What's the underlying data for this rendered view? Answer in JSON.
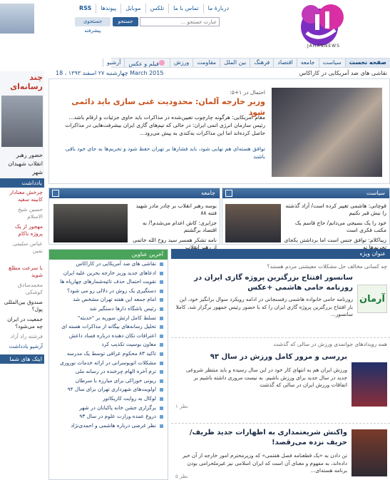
{
  "top_nav": [
    "دربارهٔ ما",
    "تماس با ما",
    "تلکس",
    "موبایل",
    "پیوندها",
    "RSS"
  ],
  "search": {
    "placeholder": "عبارت جستجو ...",
    "button": "جستجو",
    "advanced": "جستجوی پیشرفته"
  },
  "logo": {
    "en": "JAHANNEWS"
  },
  "main_nav": [
    "صفحه نخست",
    "سیاست",
    "جامعه",
    "اقتصاد",
    "فرهنگ",
    "بین الملل",
    "مقاومت",
    "ورزش",
    "فیلم و عکس",
    "آرشیو"
  ],
  "ticker": "نقاشی های ضد آمریکایی در کاراکاس",
  "date": "چهارشنبه ۲۷ اسفند ۱۳۹۳ ، 18 March 2015",
  "featured": {
    "kicker": "احتمال در ۱+۵:",
    "title": "وزیر خارجه آلمان: محدودیت غنی سازی باید دائمی شود",
    "body": "مقام آمریکایی: هرگونه چارچوب تعیین‌شده در مذاکرات باید حاوی جزئیات و ارقام باشد... رئیس سازمان انرژی اتمی ایران: در حالی که تیم‌های گازی ایران بیشرفت‌هایی در مذاکرات حاصل کرده‌اند اما این مذاکرات به‌کندی به پیش می‌رود...",
    "links": "توافق هسته‌ای هم نهایی شود، باید فشارها بر تهران حفظ شود و تحریم‌ها به جای خود باقی باشند"
  },
  "politics": {
    "title": "سیاست",
    "items": [
      "قوچانی: هاشمی تغییر کرده است/ آزاد گذشته را نبش قبر نکنیم",
      "خود را یک بسیجی می‌دانم/ حاج قاسم یک مکتب فکری است",
      "زیباکلام: توافق جنس است اما برداشتن یکجای تحریم‌ها نه"
    ]
  },
  "society": {
    "title": "جامعه",
    "items": [
      "بوسه رهبر انقلاب بر چادر مادر شهید فتنه ۸۸",
      "جزایری: کاش اعدام می‌شدم!/ به اقتصاد برگشتم",
      "نامه تشکر همسر سید روح الله خاتمی از رهبر انقلاب"
    ]
  },
  "left_col": {
    "headline": "چند رسانه‌ای",
    "caption": "حضور رهبر انقلاب شهیدان شهر",
    "section": "یادداشت",
    "notes": [
      "چرخش معنادار کابینه سفید",
      "حسین شیخ الاسلام",
      "مهجور از یک پروژه ناکام",
      "عباس سلیمی نمین"
    ],
    "notes2": [
      "با سرعت مطلع شوید",
      "محمدصادق کوشکی",
      "صندوق بین‌المللی پول؟",
      "جمعیت در ایران چه می‌شود؟",
      "فرشته راد آزاد"
    ],
    "arch": "آرشیو یادداشت",
    "socials": "ایتک های شما"
  },
  "latest": {
    "title": "آخرین عناوین",
    "items": [
      "نقاشی های ضد آمریکایی در کاراکاس",
      "ادعاهای جدید وزیر خارجه بحرین علیه ایران",
      "تقویت احتمال حذف تائیه‌شمارهای چهارپاه ها",
      "دستگیری یک روش در دلالی رو می شود؟",
      "امام جمعه این هفته تهران مشخص شد",
      "رئیس باشگاه دارها دستگیر شد",
      "تسلط کامل ارتش سوریه بر \"حدیثه\"",
      "تحلیل رسانه‌های بیگانه از مذاکرات هسته ای",
      "اعترافات تکان دهنده درباره فساد داعش",
      "معاون بوسیت تکذیب کرد",
      "تاکید ۸۳ محکوم عراقی توسط یک مدرسه",
      "مشکلات اتوبوسرانی در ارائه خدمات نوروزی",
      "ترم آخره الهام چرخنده در رسانه ملی",
      "ریونی خوزاکی برای مبارزه با سرطان",
      "اولویت‌های شهرداری تهران برای سال ۹۴",
      "لوکال به روایت کاریکاتور",
      "برگزاری جشن خانه پاکبانان در شهر",
      "دروغ عمده وزارت علوم در سال ۹۳",
      "نظر غرضی درباره هاشمی و احمدی‌نژاد"
    ]
  },
  "special": {
    "title": "عنوان ویژه",
    "items": [
      {
        "kicker": "چه کسانی مخالف حل مشکلات معیشتی مردم هستند؟",
        "title": "سانسور افتتاح بزرگترین پروژه گازی ایران در روزنامه حامی هاشمی +عکس",
        "body": "روزنامه حامی خانواده هاشمی رفسنجانی در ادامه رویکرد سوال برانگیز خود، این بار افتتاح بزرگترین پروژه گازی ایران را که با حضور رئیس جمهور برگزار شد، کاملا سانسور...",
        "meta": "۲ نظر"
      },
      {
        "kicker": "همه رویدادهای جوانمدی ورزش در سالی که گذشت",
        "title": "بررسی و مرور کامل ورزش در سال ۹۳",
        "body": "ورزش ایران هم به انتهای کار خود در این سال رسیده و باید منتظر شروعی جدید در سال جدید برای ورزش باشیم. به نیست مروری داشته باشیم بر اتفاقات ورزش ایران در سالی که گذشت",
        "meta": "۱ نظر"
      },
      {
        "kicker": "",
        "title": "واکنش شریعتمداری به اظهارات جدید ظریف/ حریف نزده می‌رقصد!",
        "body": "تن دادن به «یک قطعنامه فصل هفتمی» که وزیرمحترم امور خارجه از آن خبر داده‌اند، به مفهوم و معنای آن است که ایران اسلامی نیز غیرملحرامی بودن برنامه هسته‌ای...",
        "meta": "۵ نظر"
      }
    ]
  }
}
